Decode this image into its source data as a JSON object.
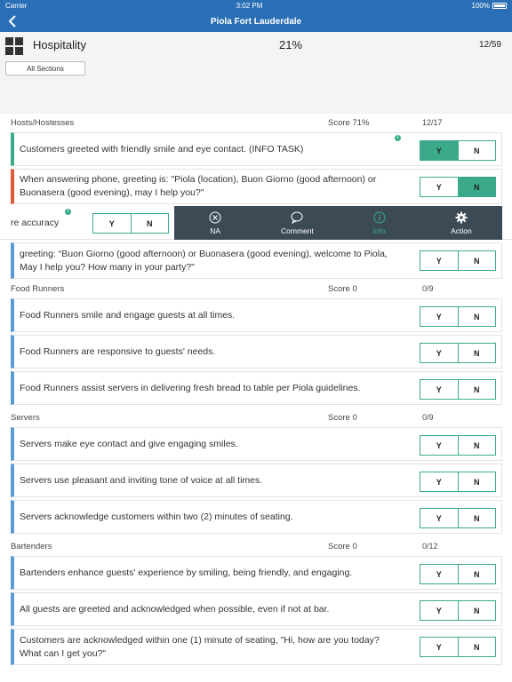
{
  "status_bar": {
    "carrier": "Carrier",
    "time": "3:02 PM",
    "battery": "100%"
  },
  "nav": {
    "title": "Piola Fort Lauderdale"
  },
  "header": {
    "section_title": "Hospitality",
    "percent": "21%",
    "count": "12/59",
    "all_sections_label": "All Sections"
  },
  "sections": [
    {
      "name": "Hosts/Hostesses",
      "score": "Score  71%",
      "fraction": "12/17"
    },
    {
      "name": "Food Runners",
      "score": "Score  0",
      "fraction": "0/9"
    },
    {
      "name": "Servers",
      "score": "Score  0",
      "fraction": "0/9"
    },
    {
      "name": "Bartenders",
      "score": "Score  0",
      "fraction": "0/12"
    }
  ],
  "questions": [
    {
      "text": "Customers greeted with friendly smile and eye contact. (INFO TASK)",
      "y": "Y",
      "n": "N",
      "selected": "Y"
    },
    {
      "text": "When answering phone, greeting is: \"Piola (location), Buon Giorno (good afternoon) or Buonasera (good evening), may I help you?\"",
      "y": "Y",
      "n": "N",
      "selected": "N"
    },
    {
      "text": "re accuracy",
      "y": "Y",
      "n": "N",
      "selected": ""
    },
    {
      "text": "greeting: “Buon Giorno (good afternoon) or Buonasera (good evening), welcome to Piola, May I help you? How many in your party?\"",
      "y": "Y",
      "n": "N",
      "selected": ""
    },
    {
      "text": "Food Runners smile and engage guests at all times.",
      "y": "Y",
      "n": "N",
      "selected": ""
    },
    {
      "text": "Food Runners are responsive to guests' needs.",
      "y": "Y",
      "n": "N",
      "selected": ""
    },
    {
      "text": "Food Runners assist servers in delivering fresh bread to table per Piola guidelines.",
      "y": "Y",
      "n": "N",
      "selected": ""
    },
    {
      "text": "Servers make eye contact and give engaging smiles.",
      "y": "Y",
      "n": "N",
      "selected": ""
    },
    {
      "text": "Servers use pleasant and inviting tone of voice at all times.",
      "y": "Y",
      "n": "N",
      "selected": ""
    },
    {
      "text": "Servers acknowledge customers within two (2) minutes of seating.",
      "y": "Y",
      "n": "N",
      "selected": ""
    },
    {
      "text": "Bartenders enhance guests' experience by smiling, being friendly, and engaging.",
      "y": "Y",
      "n": "N",
      "selected": ""
    },
    {
      "text": "All guests are greeted and acknowledged when possible, even if not at bar.",
      "y": "Y",
      "n": "N",
      "selected": ""
    },
    {
      "text": "Customers are acknowledged within one (1) minute of seating, \"Hi, how are you today? What can I get you?\"",
      "y": "Y",
      "n": "N",
      "selected": ""
    }
  ],
  "action_bar": [
    {
      "label": "NA",
      "icon": "close-circle-icon"
    },
    {
      "label": "Comment",
      "icon": "comment-icon"
    },
    {
      "label": "Info",
      "icon": "info-icon"
    },
    {
      "label": "Action",
      "icon": "gear-icon"
    }
  ],
  "colors": {
    "nav": "#2a6fb5",
    "accent": "#3aaa8a",
    "flag_red": "#e05a38",
    "row_blue": "#5b9bd5",
    "action_bar": "#3c4a55"
  }
}
